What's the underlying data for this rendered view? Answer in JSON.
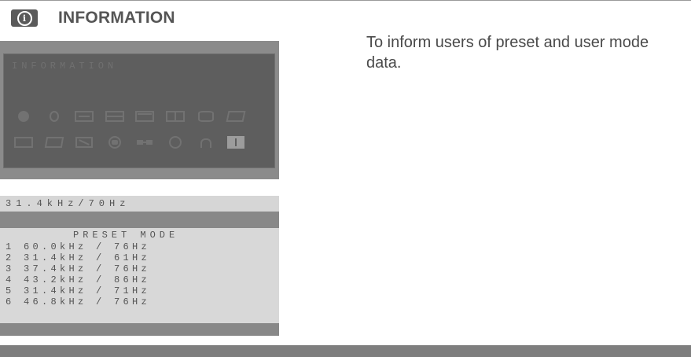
{
  "section": {
    "title": "INFORMATION",
    "icon": "info-icon"
  },
  "description": "To inform users of preset and user mode data.",
  "osd": {
    "menu_title": "INFORMATION",
    "icons_row1": [
      "brightness-icon",
      "contrast-icon",
      "h-position-icon",
      "h-size-icon",
      "v-position-icon",
      "v-size-icon",
      "pincushion-icon",
      "trapezoid-icon"
    ],
    "icons_row2": [
      "parallelogram-icon",
      "pinbalance-icon",
      "color-icon",
      "language-icon",
      "moire-icon",
      "degauss-icon",
      "recall-icon",
      "information-icon"
    ]
  },
  "status": {
    "frequency": "31.4kHz/70Hz"
  },
  "preset": {
    "title": "PRESET MODE",
    "modes": [
      "1 60.0kHz / 76Hz",
      "2 31.4kHz / 61Hz",
      "3 37.4kHz / 76Hz",
      "4 43.2kHz / 86Hz",
      "5 31.4kHz / 71Hz",
      "6 46.8kHz / 76Hz"
    ]
  },
  "colors": {
    "badge": "#5a5a5a",
    "osd_bg": "#8b8b8b",
    "osd_inner": "#5e5e5e",
    "panel_light": "#d8d8d8",
    "bottom_bar": "#7e7e7e"
  }
}
